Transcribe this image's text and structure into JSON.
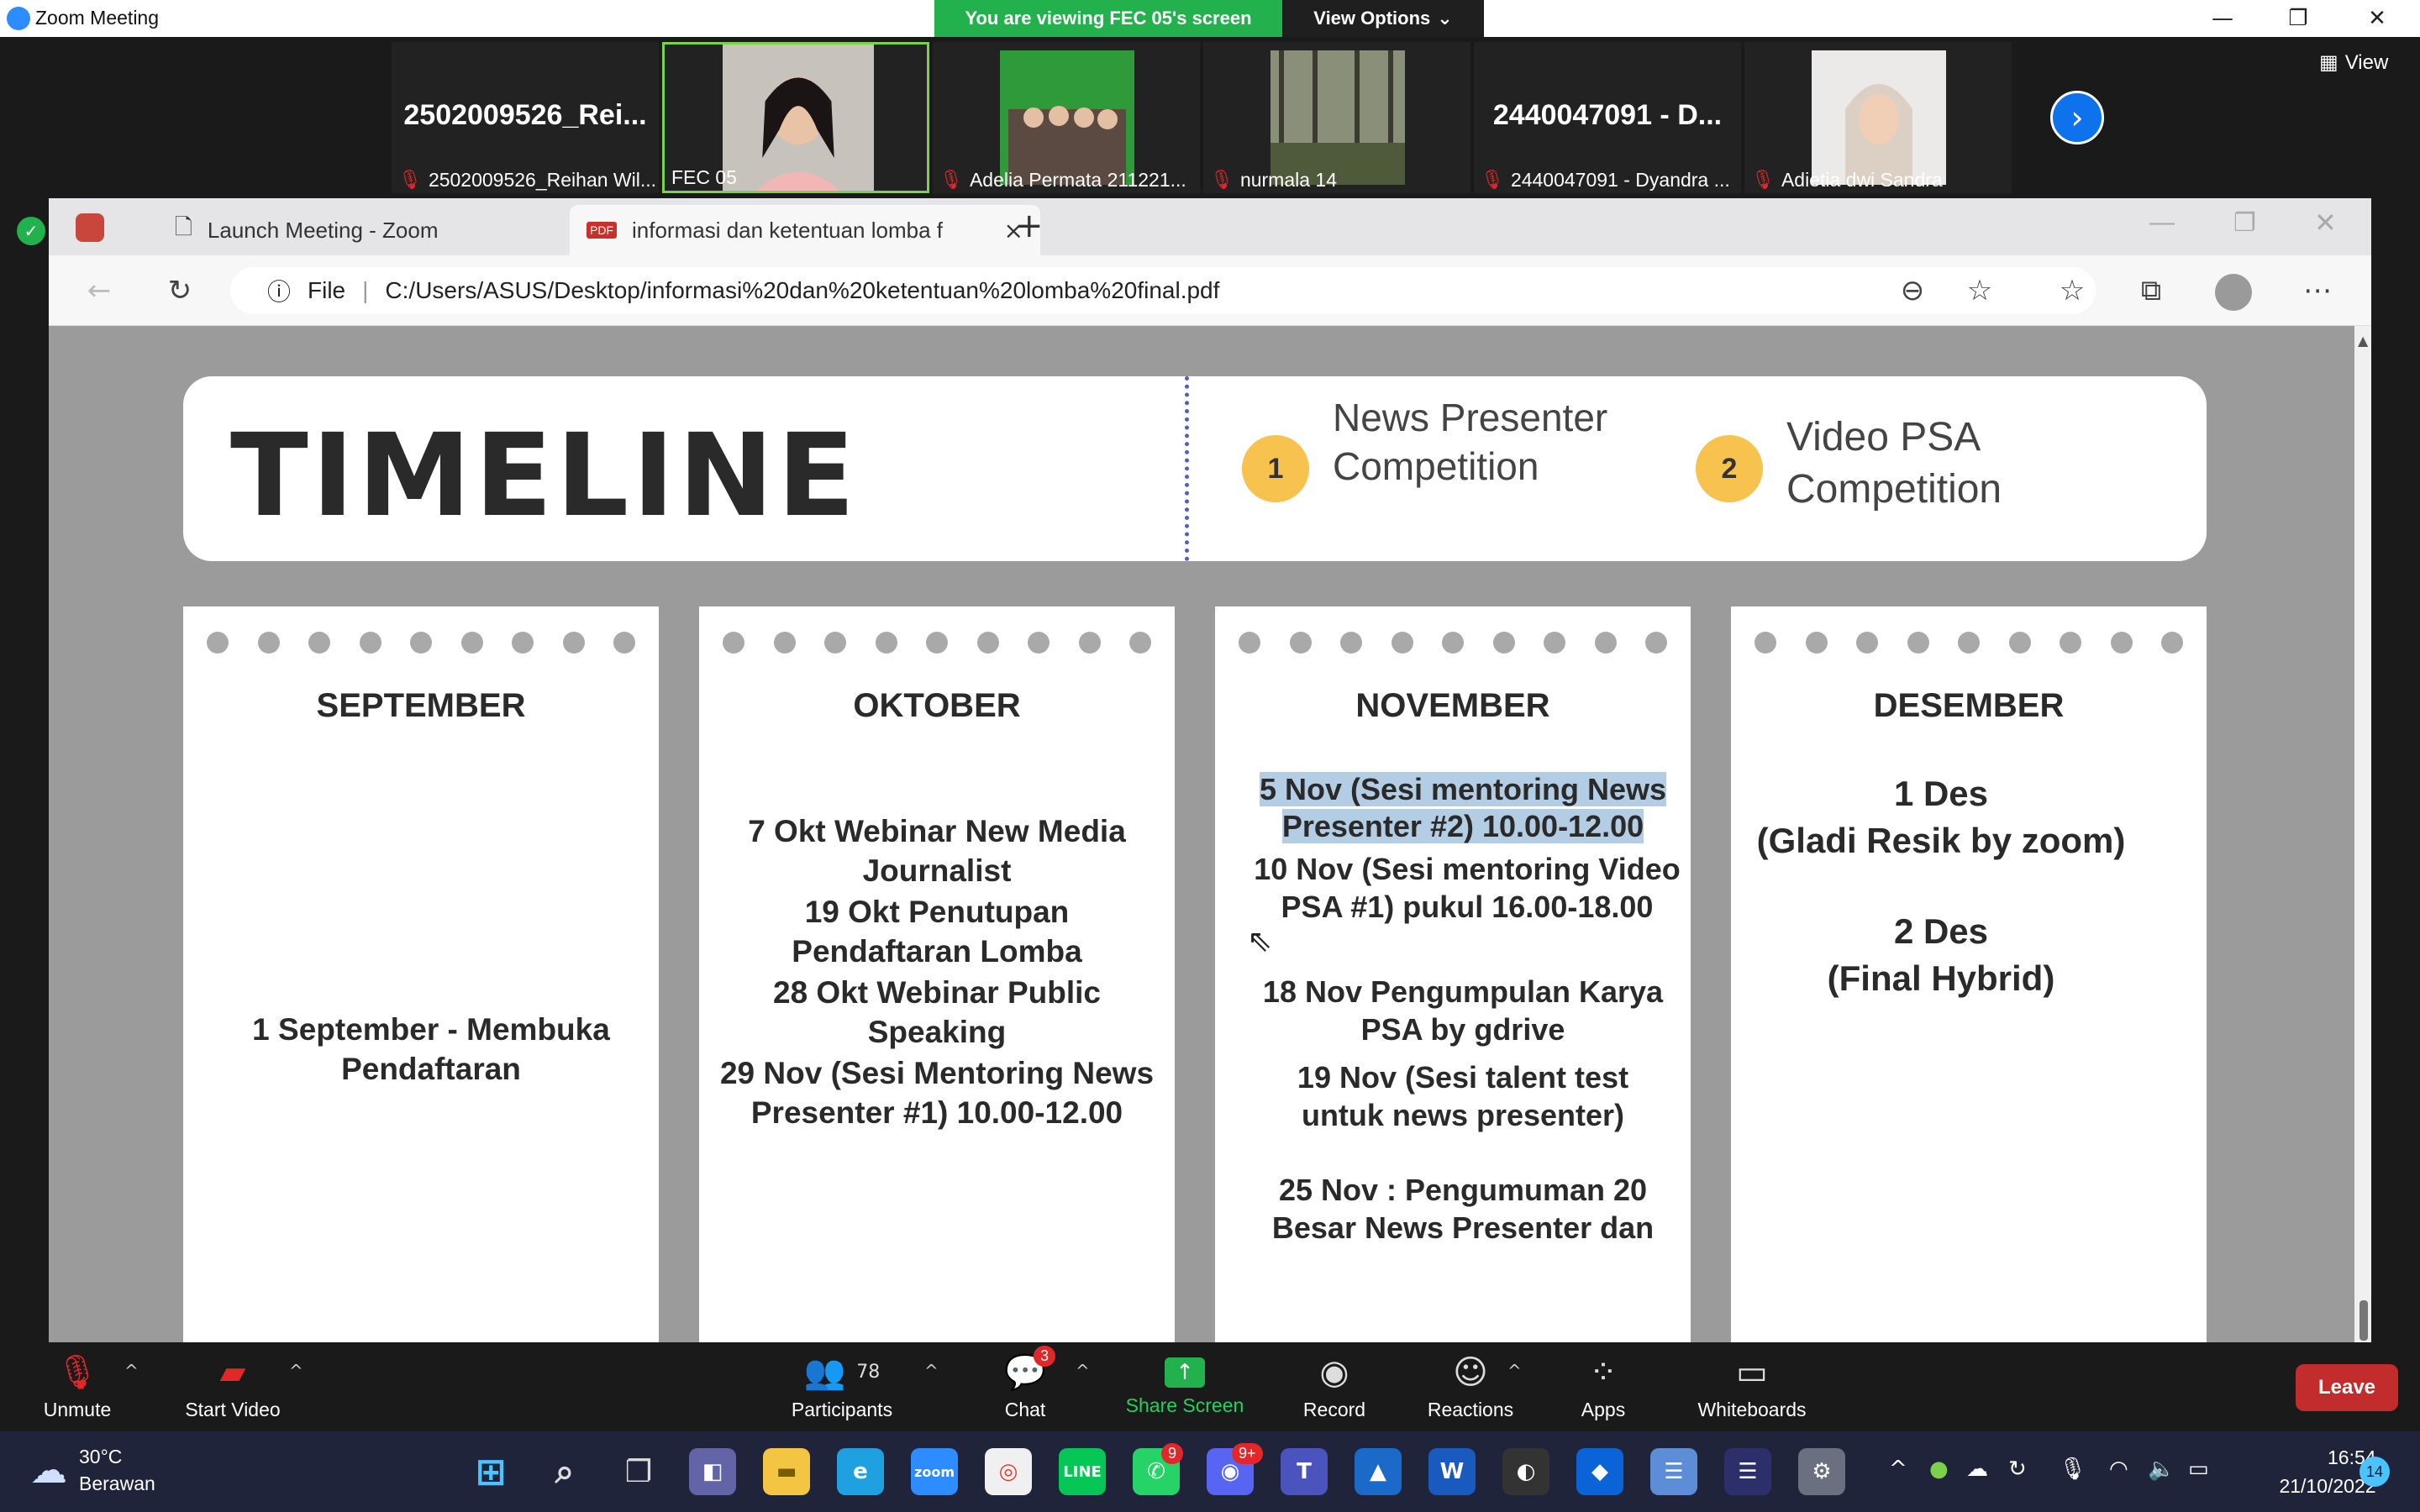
{
  "window": {
    "title": "Zoom Meeting"
  },
  "banner": {
    "viewing_text": "You are viewing FEC 05's screen",
    "view_options": "View Options"
  },
  "participants_strip": {
    "tiles": [
      {
        "big_name": "2502009526_Rei...",
        "label": "2502009526_Reihan Wil..."
      },
      {
        "label": "FEC 05"
      },
      {
        "label": "Adelia Permata 211221..."
      },
      {
        "label": "nurmala 14"
      },
      {
        "big_name": "2440047091 - D...",
        "label": "2440047091 - Dyandra ..."
      },
      {
        "label": "Adietia dwi Sandra"
      }
    ],
    "view_label": "View"
  },
  "browser": {
    "tabs": [
      {
        "label": "Launch Meeting - Zoom"
      },
      {
        "label": "informasi dan ketentuan lomba f"
      }
    ],
    "url_scheme": "File",
    "url": "C:/Users/ASUS/Desktop/informasi%20dan%20ketentuan%20lomba%20final.pdf"
  },
  "pdf": {
    "title": "TIMELINE",
    "competitions": [
      {
        "number": "1",
        "name": "News Presenter Competition"
      },
      {
        "number": "2",
        "name": "Video PSA Competition"
      }
    ],
    "months": [
      {
        "name": "SEPTEMBER",
        "events": [
          "1 September - Membuka Pendaftaran"
        ]
      },
      {
        "name": "OKTOBER",
        "events": [
          "7 Okt Webinar New Media Journalist",
          "19 Okt Penutupan Pendaftaran Lomba",
          "28 Okt  Webinar Public Speaking",
          "29 Nov (Sesi Mentoring News Presenter #1) 10.00-12.00"
        ]
      },
      {
        "name": "NOVEMBER",
        "events": [
          "5 Nov (Sesi mentoring News Presenter #2) 10.00-12.00",
          "10 Nov  (Sesi mentoring Video PSA #1) pukul 16.00-18.00",
          "18 Nov Pengumpulan Karya PSA by gdrive",
          "19 Nov (Sesi talent test untuk news presenter)",
          "25 Nov : Pengumuman 20 Besar News Presenter dan"
        ]
      },
      {
        "name": "DESEMBER",
        "events": [
          "1 Des",
          "(Gladi Resik by zoom)",
          "2 Des",
          "(Final Hybrid)"
        ]
      }
    ]
  },
  "toolbar": {
    "unmute": "Unmute",
    "start_video": "Start Video",
    "participants": "Participants",
    "participants_count": "78",
    "chat": "Chat",
    "chat_badge": "3",
    "share_screen": "Share Screen",
    "record": "Record",
    "reactions": "Reactions",
    "apps": "Apps",
    "whiteboards": "Whiteboards",
    "leave": "Leave"
  },
  "taskbar": {
    "temperature": "30°C",
    "weather": "Berawan",
    "time": "16:54",
    "date": "21/10/2022",
    "notifications": "14",
    "whatsapp_badge": "9",
    "discord_badge": "9+"
  },
  "colors": {
    "zoom_blue": "#2d8cff",
    "share_green": "#23b14d",
    "leave_red": "#c22c2c",
    "highlight": "#b3cde4",
    "badge_yellow": "#f7c24e"
  }
}
